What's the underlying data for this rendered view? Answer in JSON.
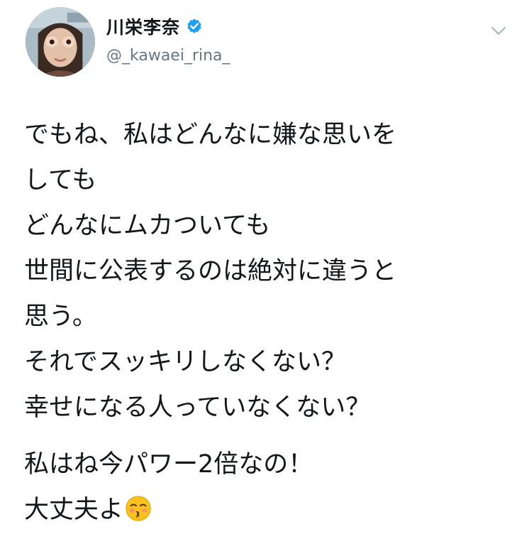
{
  "tweet": {
    "display_name": "川栄李奈",
    "handle": "@_kawaei_rina_",
    "verified": true,
    "icons": {
      "verified": "verified-badge-icon",
      "caret": "chevron-down-icon",
      "emoji": "kissing-face-emoji"
    },
    "colors": {
      "verified": "#1da1f2",
      "handle": "#657786"
    },
    "lines": [
      "でもね、私はどんなに嫌な思いを",
      "しても",
      "どんなにムカついても",
      "世間に公表するのは絶対に違うと",
      "思う。",
      "それでスッキリしなくない？",
      "幸せになる人っていなくない？"
    ],
    "lines2": [
      "私はね今パワー2倍なの！",
      "大丈夫よ"
    ]
  }
}
